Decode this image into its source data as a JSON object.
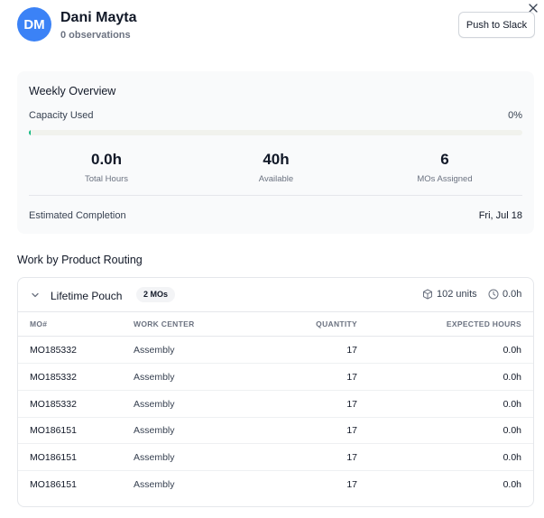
{
  "user": {
    "initials": "DM",
    "name": "Dani Mayta",
    "observations": "0 observations"
  },
  "actions": {
    "push_label": "Push to Slack"
  },
  "overview": {
    "title": "Weekly Overview",
    "capacity_label": "Capacity Used",
    "capacity_pct": "0%",
    "capacity_fraction": 0,
    "stats": [
      {
        "value": "0.0h",
        "label": "Total Hours"
      },
      {
        "value": "40h",
        "label": "Available"
      },
      {
        "value": "6",
        "label": "MOs Assigned"
      }
    ],
    "completion_label": "Estimated Completion",
    "completion_value": "Fri, Jul 18"
  },
  "routing": {
    "section_title": "Work by Product Routing",
    "product": "Lifetime Pouch",
    "badge": "2 MOs",
    "units": "102 units",
    "hours": "0.0h",
    "columns": [
      "MO#",
      "WORK CENTER",
      "QUANTITY",
      "EXPECTED HOURS"
    ],
    "rows": [
      {
        "mo": "MO185332",
        "work_center": "Assembly",
        "quantity": "17",
        "hours": "0.0h"
      },
      {
        "mo": "MO185332",
        "work_center": "Assembly",
        "quantity": "17",
        "hours": "0.0h"
      },
      {
        "mo": "MO185332",
        "work_center": "Assembly",
        "quantity": "17",
        "hours": "0.0h"
      },
      {
        "mo": "MO186151",
        "work_center": "Assembly",
        "quantity": "17",
        "hours": "0.0h"
      },
      {
        "mo": "MO186151",
        "work_center": "Assembly",
        "quantity": "17",
        "hours": "0.0h"
      },
      {
        "mo": "MO186151",
        "work_center": "Assembly",
        "quantity": "17",
        "hours": "0.0h"
      }
    ]
  },
  "colors": {
    "avatar": "#3b82f6",
    "progress": "#10b981",
    "panel": "#f9fafb"
  },
  "icons": {
    "close": "close-icon",
    "chevron": "chevron-down-icon",
    "units": "box-icon",
    "hours": "clock-icon"
  }
}
